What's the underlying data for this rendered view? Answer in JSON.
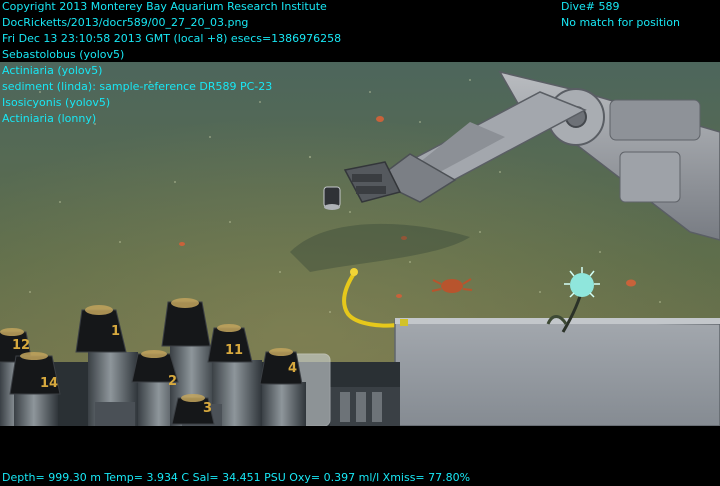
{
  "overlay": {
    "header_left": [
      "Copyright 2013 Monterey Bay Aquarium Research Institute",
      "DocRicketts/2013/docr589/00_27_20_03.png",
      "Fri Dec 13 23:10:58 2013 GMT (local +8)  esecs=1386976258",
      "Sebastolobus (yolov5)",
      "Actiniaria (yolov5)",
      "sediment (linda): sample-reference DR589 PC-23",
      "Isosicyonis (yolov5)",
      "Actiniaria (lonny)"
    ],
    "header_right": [
      "Dive# 589",
      "No match for position"
    ],
    "footer": "Depth= 999.30 m  Temp= 3.934 C  Sal= 34.451 PSU  Oxy= 0.397 ml/l  Xmiss= 77.80%"
  },
  "image": {
    "subject": "deep-sea seafloor with ROV manipulator arm and push-core tubes",
    "text_color": "#18e7f4",
    "tube_labels": [
      "1",
      "2",
      "3",
      "4",
      "14",
      "11",
      "12"
    ]
  }
}
